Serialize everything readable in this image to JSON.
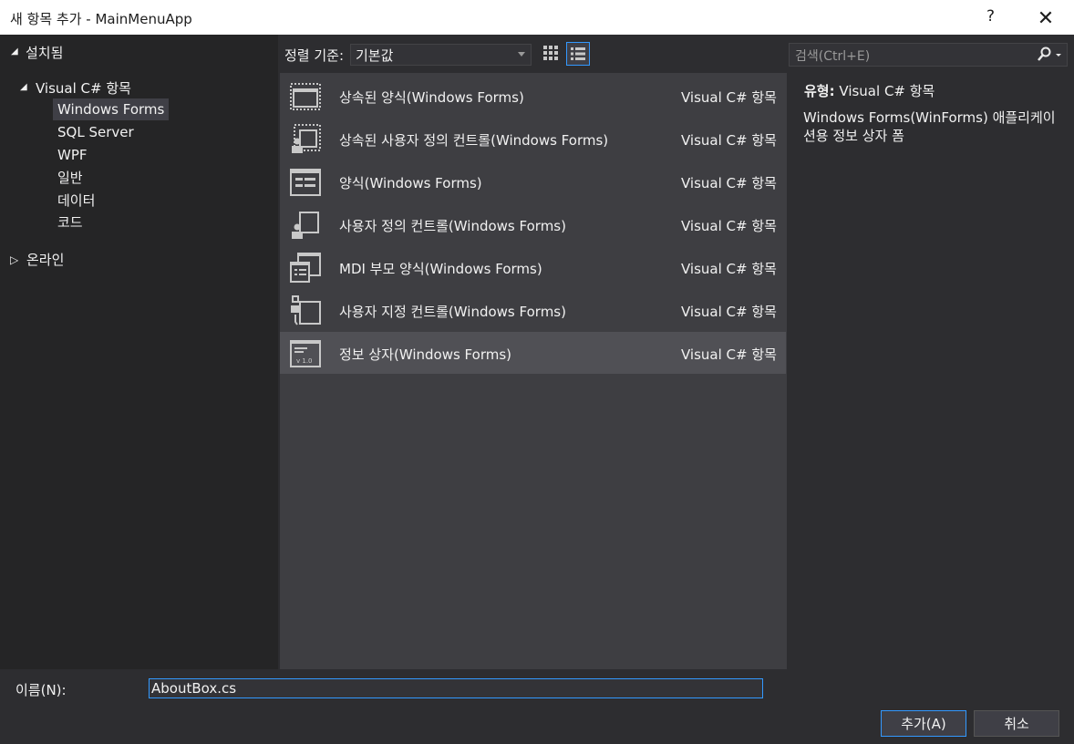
{
  "window": {
    "title": "새 항목 추가 - MainMenuApp",
    "help": "?",
    "close": "✕"
  },
  "tree": {
    "installed": "설치됨",
    "csharp": "Visual C# 항목",
    "children": [
      "Windows Forms",
      "SQL Server",
      "WPF",
      "일반",
      "데이터",
      "코드"
    ],
    "online": "온라인",
    "selected": "Windows Forms"
  },
  "sort": {
    "label": "정렬 기준:",
    "value": "기본값"
  },
  "items": [
    {
      "name": "상속된 양식(Windows Forms)",
      "category": "Visual C# 항목",
      "icon": "inherited-form-icon"
    },
    {
      "name": "상속된 사용자 정의 컨트롤(Windows Forms)",
      "category": "Visual C# 항목",
      "icon": "inherited-user-control-icon"
    },
    {
      "name": "양식(Windows Forms)",
      "category": "Visual C# 항목",
      "icon": "form-icon"
    },
    {
      "name": "사용자 정의 컨트롤(Windows Forms)",
      "category": "Visual C# 항목",
      "icon": "user-control-icon"
    },
    {
      "name": "MDI 부모 양식(Windows Forms)",
      "category": "Visual C# 항목",
      "icon": "mdi-parent-form-icon"
    },
    {
      "name": "사용자 지정 컨트롤(Windows Forms)",
      "category": "Visual C# 항목",
      "icon": "custom-control-icon"
    },
    {
      "name": "정보 상자(Windows Forms)",
      "category": "Visual C# 항목",
      "icon": "about-box-icon",
      "icon_text": "v 1.0"
    }
  ],
  "selected_item": "정보 상자(Windows Forms)",
  "search": {
    "placeholder": "검색(Ctrl+E)"
  },
  "details": {
    "type_label": "유형:",
    "type_value": "Visual C# 항목",
    "description": "Windows Forms(WinForms) 애플리케이션용 정보 상자 폼"
  },
  "bottom": {
    "name_label": "이름(N):",
    "name_value": "AboutBox.cs",
    "add_button": "추가(A)",
    "cancel_button": "취소"
  },
  "colors": {
    "background": "#2d2d30",
    "list": "#3e3e42",
    "selected": "#505055",
    "accent": "#3399ff"
  }
}
